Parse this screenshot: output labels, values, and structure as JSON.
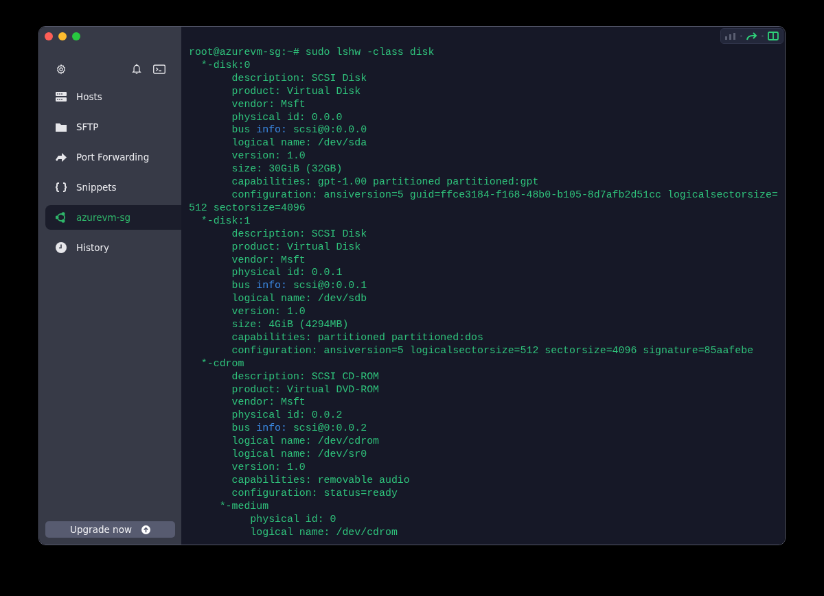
{
  "sidebar": {
    "items": [
      {
        "label": "Hosts",
        "kind": "hosts",
        "selected": false
      },
      {
        "label": "SFTP",
        "kind": "folder",
        "selected": false
      },
      {
        "label": "Port Forwarding",
        "kind": "forward",
        "selected": false
      },
      {
        "label": "Snippets",
        "kind": "braces",
        "selected": false
      },
      {
        "label": "azurevm-sg",
        "kind": "ubuntu",
        "selected": true
      },
      {
        "label": "History",
        "kind": "clock",
        "selected": false
      }
    ],
    "upgrade_button": "Upgrade now"
  },
  "terminal": {
    "lines": [
      [
        {
          "text": "root@azurevm-sg:~# sudo lshw -class disk",
          "kind": "plain"
        }
      ],
      [
        {
          "text": "  *-disk:0",
          "kind": "plain"
        }
      ],
      [
        {
          "text": "       description: SCSI Disk",
          "kind": "plain"
        }
      ],
      [
        {
          "text": "       product: Virtual Disk",
          "kind": "plain"
        }
      ],
      [
        {
          "text": "       vendor: Msft",
          "kind": "plain"
        }
      ],
      [
        {
          "text": "       physical id: 0.0.0",
          "kind": "plain"
        }
      ],
      [
        {
          "text": "       bus ",
          "kind": "plain"
        },
        {
          "text": "info:",
          "kind": "keyword"
        },
        {
          "text": " scsi@0:0.0.0",
          "kind": "plain"
        }
      ],
      [
        {
          "text": "       logical name: /dev/sda",
          "kind": "plain"
        }
      ],
      [
        {
          "text": "       version: 1.0",
          "kind": "plain"
        }
      ],
      [
        {
          "text": "       size: 30GiB (32GB)",
          "kind": "plain"
        }
      ],
      [
        {
          "text": "       capabilities: gpt-1.00 partitioned partitioned:gpt",
          "kind": "plain"
        }
      ],
      [
        {
          "text": "       configuration: ansiversion=5 guid=ffce3184-f168-48b0-b105-8d7afb2d51cc logicalsectorsize=",
          "kind": "plain"
        }
      ],
      [
        {
          "text": "512 sectorsize=4096",
          "kind": "plain"
        }
      ],
      [
        {
          "text": "  *-disk:1",
          "kind": "plain"
        }
      ],
      [
        {
          "text": "       description: SCSI Disk",
          "kind": "plain"
        }
      ],
      [
        {
          "text": "       product: Virtual Disk",
          "kind": "plain"
        }
      ],
      [
        {
          "text": "       vendor: Msft",
          "kind": "plain"
        }
      ],
      [
        {
          "text": "       physical id: 0.0.1",
          "kind": "plain"
        }
      ],
      [
        {
          "text": "       bus ",
          "kind": "plain"
        },
        {
          "text": "info:",
          "kind": "keyword"
        },
        {
          "text": " scsi@0:0.0.1",
          "kind": "plain"
        }
      ],
      [
        {
          "text": "       logical name: /dev/sdb",
          "kind": "plain"
        }
      ],
      [
        {
          "text": "       version: 1.0",
          "kind": "plain"
        }
      ],
      [
        {
          "text": "       size: 4GiB (4294MB)",
          "kind": "plain"
        }
      ],
      [
        {
          "text": "       capabilities: partitioned partitioned:dos",
          "kind": "plain"
        }
      ],
      [
        {
          "text": "       configuration: ansiversion=5 logicalsectorsize=512 sectorsize=4096 signature=85aafebe",
          "kind": "plain"
        }
      ],
      [
        {
          "text": "  *-cdrom",
          "kind": "plain"
        }
      ],
      [
        {
          "text": "       description: SCSI CD-ROM",
          "kind": "plain"
        }
      ],
      [
        {
          "text": "       product: Virtual DVD-ROM",
          "kind": "plain"
        }
      ],
      [
        {
          "text": "       vendor: Msft",
          "kind": "plain"
        }
      ],
      [
        {
          "text": "       physical id: 0.0.2",
          "kind": "plain"
        }
      ],
      [
        {
          "text": "       bus ",
          "kind": "plain"
        },
        {
          "text": "info:",
          "kind": "keyword"
        },
        {
          "text": " scsi@0:0.0.2",
          "kind": "plain"
        }
      ],
      [
        {
          "text": "       logical name: /dev/cdrom",
          "kind": "plain"
        }
      ],
      [
        {
          "text": "       logical name: /dev/sr0",
          "kind": "plain"
        }
      ],
      [
        {
          "text": "       version: 1.0",
          "kind": "plain"
        }
      ],
      [
        {
          "text": "       capabilities: removable audio",
          "kind": "plain"
        }
      ],
      [
        {
          "text": "       configuration: status=ready",
          "kind": "plain"
        }
      ],
      [
        {
          "text": "     *-medium",
          "kind": "plain"
        }
      ],
      [
        {
          "text": "          physical id: 0",
          "kind": "plain"
        }
      ],
      [
        {
          "text": "          logical name: /dev/cdrom",
          "kind": "plain"
        }
      ]
    ]
  }
}
